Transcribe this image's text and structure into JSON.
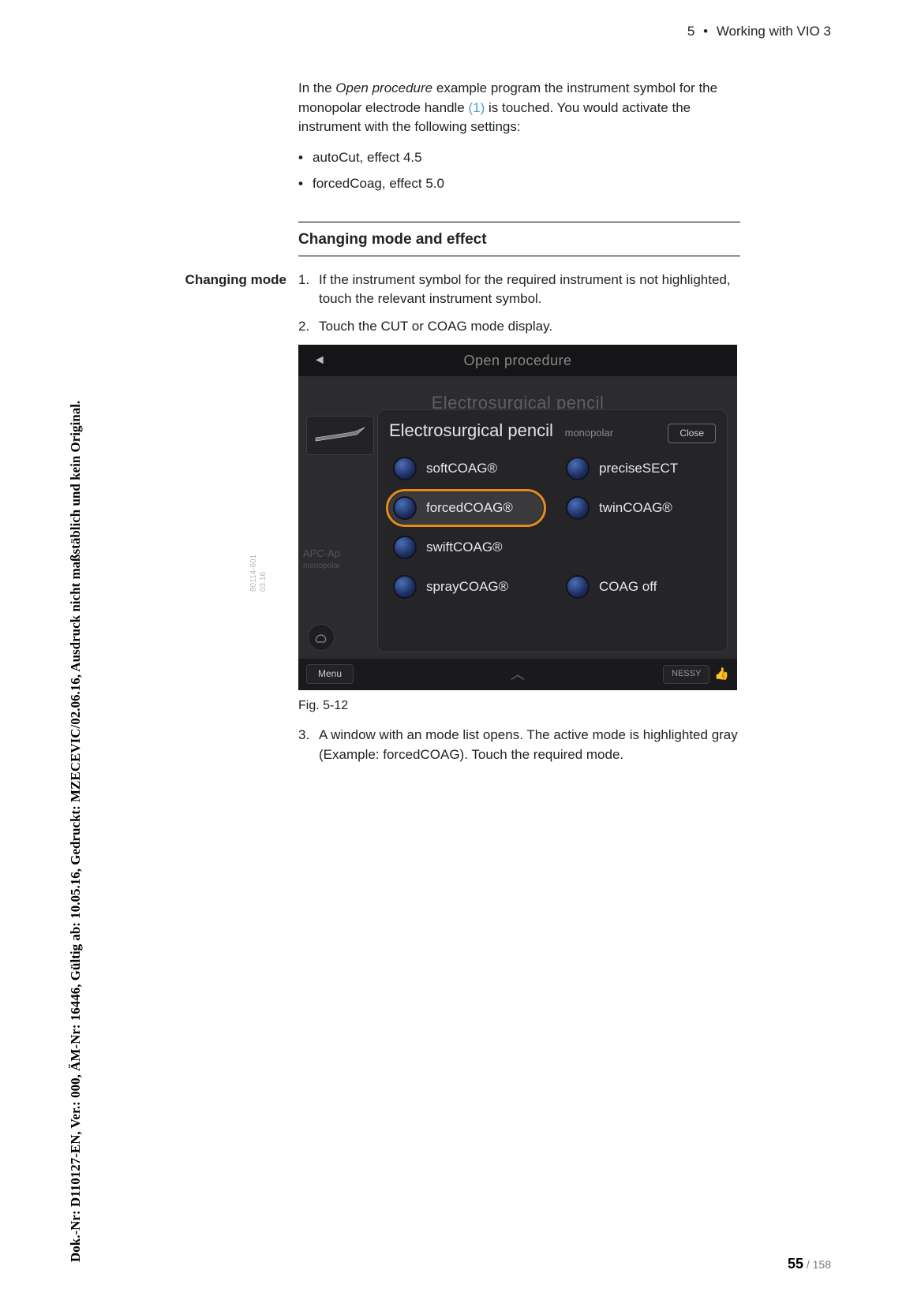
{
  "header": {
    "chapter_num": "5",
    "bullet": "•",
    "chapter_title": "Working with VIO 3"
  },
  "intro": {
    "p1_a": "In the ",
    "p1_ital": "Open procedure",
    "p1_b": " example program the instrument symbol for the monopolar electrode handle ",
    "p1_ref": "(1)",
    "p1_c": " is touched. You would activate the instrument with the following settings:",
    "bullets": [
      "autoCut, effect 4.5",
      "forcedCoag, effect 5.0"
    ]
  },
  "section": {
    "title": "Changing mode and effect",
    "margin_label": "Changing mode"
  },
  "steps": {
    "s1": "If the instrument symbol for the required instrument is not highlighted, touch the relevant instrument symbol.",
    "s2": "Touch the CUT or COAG mode display.",
    "s3": "A window with an mode list opens. The active mode is highlighted gray (Example: forcedCOAG). Touch the required mode."
  },
  "figure": {
    "caption": "Fig. 5-12"
  },
  "device": {
    "top_title": "Open procedure",
    "bg_title": "Electrosurgical pencil",
    "panel_title": "Electrosurgical pencil",
    "panel_sub": "monopolar",
    "close": "Close",
    "apc_label": "APC-Ap",
    "apc_sub": "monopolar",
    "modes": {
      "m1": "softCOAG®",
      "m2": "preciseSECT",
      "m3": "forcedCOAG®",
      "m4": "twinCOAG®",
      "m5": "swiftCOAG®",
      "m6": "sprayCOAG®",
      "m7": "COAG off"
    },
    "menu": "Menu",
    "nessy": "NESSY"
  },
  "side": {
    "vertical_text": "Dok.-Nr: D110127-EN, Ver.: 000, ÄM-Nr: 16446, Gültig ab: 10.05.16, Gedruckt: MZECEVIC/02.06.16, Ausdruck nicht maßstäblich und kein Original.",
    "code1": "80114-601",
    "code2": "03.16"
  },
  "footer": {
    "current": "55",
    "sep": " / ",
    "total": "158"
  }
}
